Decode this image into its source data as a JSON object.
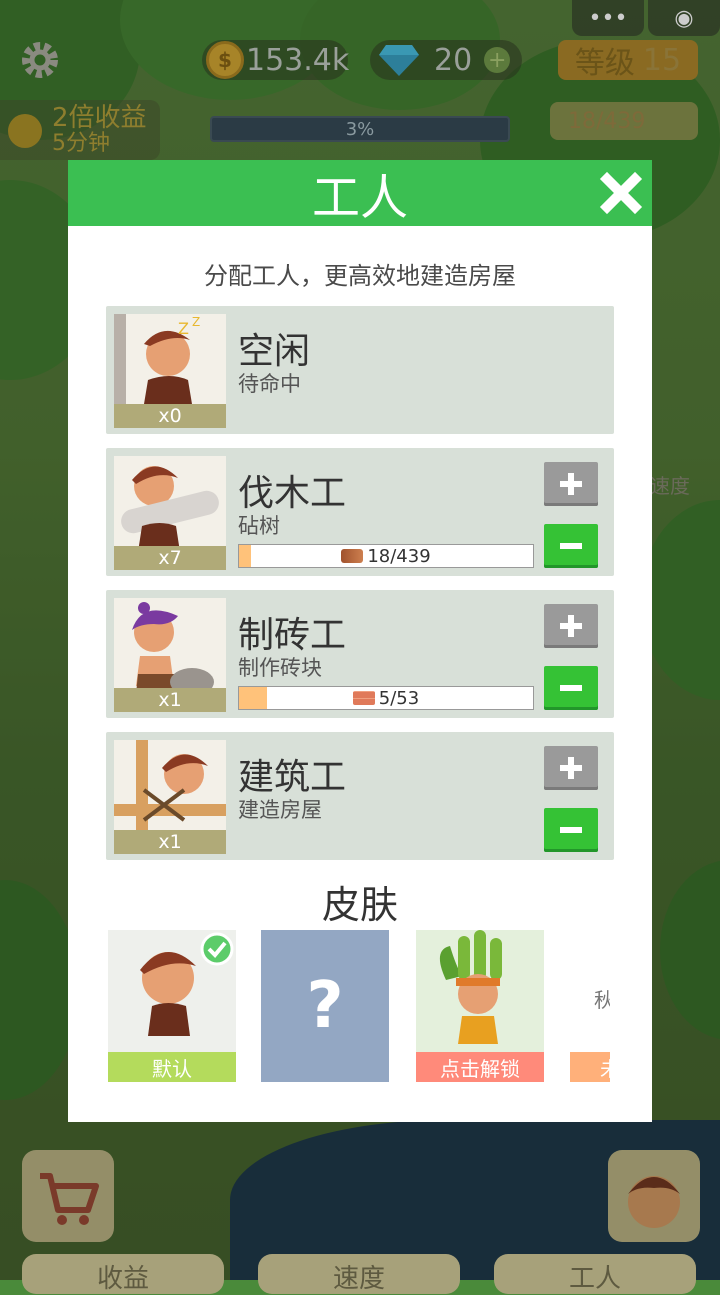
{
  "hud": {
    "coins": "153.4k",
    "gems": "20",
    "level_label": "等级",
    "level_value": "15",
    "bonus_line1": "2倍收益",
    "bonus_line2": "5分钟",
    "progress_text": "3%",
    "wood_count": "18/439",
    "side_label_speed": "速度"
  },
  "modal": {
    "title": "工人",
    "subtitle": "分配工人，更高效地建造房屋"
  },
  "workers": [
    {
      "title": "空闲",
      "subtitle": "待命中",
      "count": "x0"
    },
    {
      "title": "伐木工",
      "subtitle": "砧树",
      "count": "x7",
      "progress_text": "18/439",
      "progress_fraction": 0.041
    },
    {
      "title": "制砖工",
      "subtitle": "制作砖块",
      "count": "x1",
      "progress_text": "5/53",
      "progress_fraction": 0.094
    },
    {
      "title": "建筑工",
      "subtitle": "建造房屋",
      "count": "x1"
    }
  ],
  "skins": {
    "title": "皮肤",
    "items": [
      {
        "label": "默认",
        "label_color": "#b4db5c",
        "selected": true
      },
      {
        "label": "",
        "locked_symbol": "?"
      },
      {
        "label": "点击解锁",
        "label_color": "#ff8a7a"
      },
      {
        "label": "秋",
        "partial_label": "未"
      }
    ]
  },
  "bottom_tabs": [
    "收益",
    "速度",
    "工人"
  ],
  "colors": {
    "header_green": "#3bbf52",
    "minus_green": "#35c235",
    "plus_grey": "#9a9a9a",
    "card_bg": "#d8e0d8"
  }
}
